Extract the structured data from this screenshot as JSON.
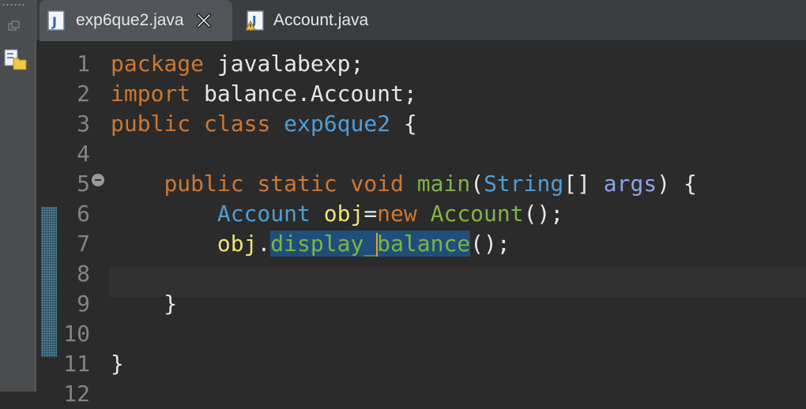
{
  "tabs": [
    {
      "label": "exp6que2.java",
      "active": true,
      "icon": "java-file-icon",
      "close_icon": "close-icon"
    },
    {
      "label": "Account.java",
      "active": false,
      "icon": "java-file-warning-icon"
    }
  ],
  "line_numbers": [
    "1",
    "2",
    "3",
    "4",
    "5",
    "6",
    "7",
    "8",
    "9",
    "10",
    "11",
    "12"
  ],
  "code_lines": [
    [
      {
        "t": "package",
        "c": "kw"
      },
      {
        "t": " javalabexp;",
        "c": ""
      }
    ],
    [
      {
        "t": "import",
        "c": "kw"
      },
      {
        "t": " balance.Account;",
        "c": ""
      }
    ],
    [
      {
        "t": "public",
        "c": "kw"
      },
      {
        "t": " ",
        "c": ""
      },
      {
        "t": "class",
        "c": "kw"
      },
      {
        "t": " ",
        "c": ""
      },
      {
        "t": "exp6que2",
        "c": "ty"
      },
      {
        "t": " {",
        "c": ""
      }
    ],
    [],
    [
      {
        "t": "    ",
        "c": ""
      },
      {
        "t": "public",
        "c": "kw"
      },
      {
        "t": " ",
        "c": ""
      },
      {
        "t": "static",
        "c": "kw"
      },
      {
        "t": " ",
        "c": ""
      },
      {
        "t": "void",
        "c": "kw"
      },
      {
        "t": " ",
        "c": ""
      },
      {
        "t": "main",
        "c": "fn"
      },
      {
        "t": "(",
        "c": ""
      },
      {
        "t": "String",
        "c": "ty"
      },
      {
        "t": "[] ",
        "c": ""
      },
      {
        "t": "args",
        "c": "pa"
      },
      {
        "t": ") {",
        "c": ""
      }
    ],
    [
      {
        "t": "        ",
        "c": ""
      },
      {
        "t": "Account",
        "c": "ty"
      },
      {
        "t": " ",
        "c": ""
      },
      {
        "t": "obj",
        "c": "va"
      },
      {
        "t": "=",
        "c": ""
      },
      {
        "t": "new",
        "c": "kw"
      },
      {
        "t": " ",
        "c": ""
      },
      {
        "t": "Account",
        "c": "fn"
      },
      {
        "t": "();",
        "c": ""
      }
    ],
    [
      {
        "t": "        ",
        "c": ""
      },
      {
        "t": "obj",
        "c": "va"
      },
      {
        "t": ".",
        "c": ""
      },
      {
        "t": "display_",
        "c": "hl"
      },
      {
        "t": "",
        "c": "caret"
      },
      {
        "t": "balance",
        "c": "hl"
      },
      {
        "t": "();",
        "c": ""
      }
    ],
    [],
    [
      {
        "t": "    }",
        "c": ""
      }
    ],
    [],
    [
      {
        "t": "}",
        "c": ""
      }
    ],
    []
  ],
  "colors": {
    "keyword": "#cc7832",
    "type": "#4f9ed6",
    "method": "#7fb347",
    "variable": "#f0e07a",
    "parameter": "#8ea3e6",
    "selection": "#1f4f78",
    "background": "#2b2b2b"
  }
}
